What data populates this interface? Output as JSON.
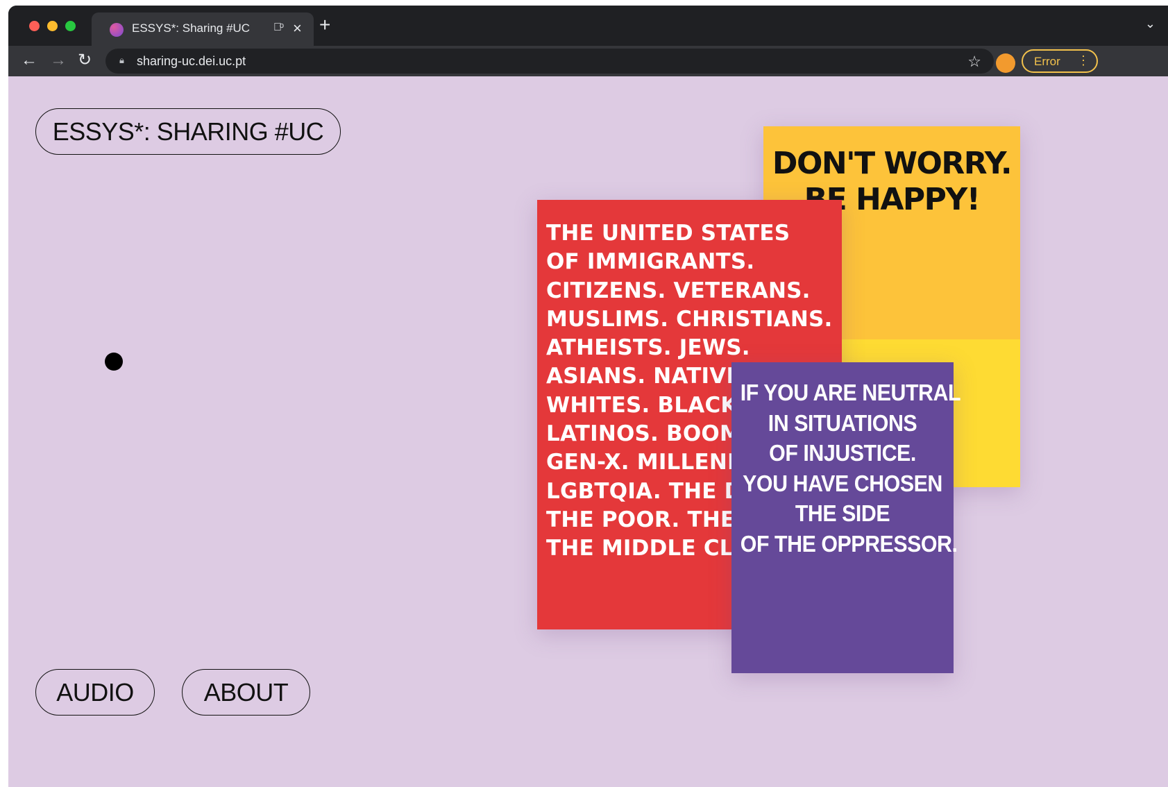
{
  "browser": {
    "tab_title": "ESSYS*: Sharing #UC",
    "tab_audio_icon": "speaker-icon",
    "tab_close": "×",
    "new_tab": "+",
    "tab_menu": "⌄",
    "url": "sharing-uc.dei.uc.pt",
    "error_label": "Error",
    "nav": {
      "back": "←",
      "forward": "→",
      "reload": "↻"
    },
    "star": "☆",
    "menu_dots": "⋮"
  },
  "site": {
    "title_button": "ESSYS*: SHARING #UC",
    "audio_button": "AUDIO",
    "about_button": "ABOUT"
  },
  "posters": {
    "yellow": {
      "text": "DON'T WORRY.\nBE HAPPY!",
      "color": "#fdc33a"
    },
    "red": {
      "text": "THE UNITED STATES\nOF IMMIGRANTS.\nCITIZENS. VETERANS.\nMUSLIMS. CHRISTIANS.\nATHEISTS. JEWS.\nASIANS. NATIVI\nWHITES. BLACKS\nLATINOS. BOOM\nGEN-X. MILLENI\nLGBTQIA. THE DI\nTHE POOR. THE 1\nTHE MIDDLE CLA",
      "color": "#e4383a"
    },
    "purple": {
      "text": "IF YOU ARE NEUTRAL\nIN SITUATIONS\nOF INJUSTICE.\nYOU HAVE CHOSEN\nTHE SIDE\nOF THE OPPRESSOR.",
      "color": "#654999"
    }
  },
  "colors": {
    "background": "#ddcbe3",
    "cursor_dot": "#000000"
  }
}
